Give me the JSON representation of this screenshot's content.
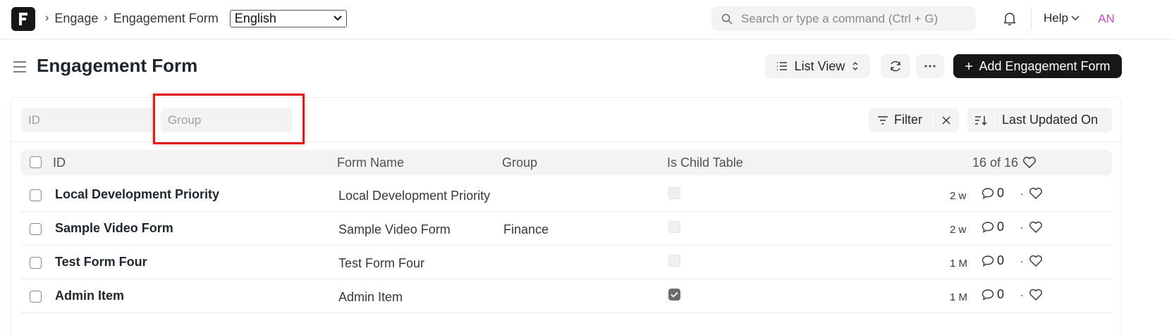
{
  "navbar": {
    "logo_letter": "F",
    "breadcrumbs": [
      "Engage",
      "Engagement Form"
    ],
    "language": "English",
    "search_placeholder": "Search or type a command (Ctrl + G)",
    "help_label": "Help",
    "avatar_initials": "AN"
  },
  "page": {
    "title": "Engagement Form",
    "list_view_label": "List View",
    "add_button_label": "Add Engagement Form"
  },
  "filters": {
    "id_placeholder": "ID",
    "group_placeholder": "Group",
    "filter_label": "Filter",
    "sort_label": "Last Updated On"
  },
  "table": {
    "columns": [
      "ID",
      "Form Name",
      "Group",
      "Is Child Table"
    ],
    "count_label": "16 of 16",
    "rows": [
      {
        "id": "Local Development Priority",
        "form_name": "Local Development Priority",
        "group": "",
        "is_child_table": false,
        "updated": "2 w",
        "comments": "0"
      },
      {
        "id": "Sample Video Form",
        "form_name": "Sample Video Form",
        "group": "Finance",
        "is_child_table": false,
        "updated": "2 w",
        "comments": "0"
      },
      {
        "id": "Test Form Four",
        "form_name": "Test Form Four",
        "group": "",
        "is_child_table": false,
        "updated": "1 M",
        "comments": "0"
      },
      {
        "id": "Admin Item",
        "form_name": "Admin Item",
        "group": "",
        "is_child_table": true,
        "updated": "1 M",
        "comments": "0"
      }
    ]
  },
  "colors": {
    "primary_dark": "#171717",
    "highlight_red": "#e01b1b",
    "avatar": "#c74fc7"
  }
}
